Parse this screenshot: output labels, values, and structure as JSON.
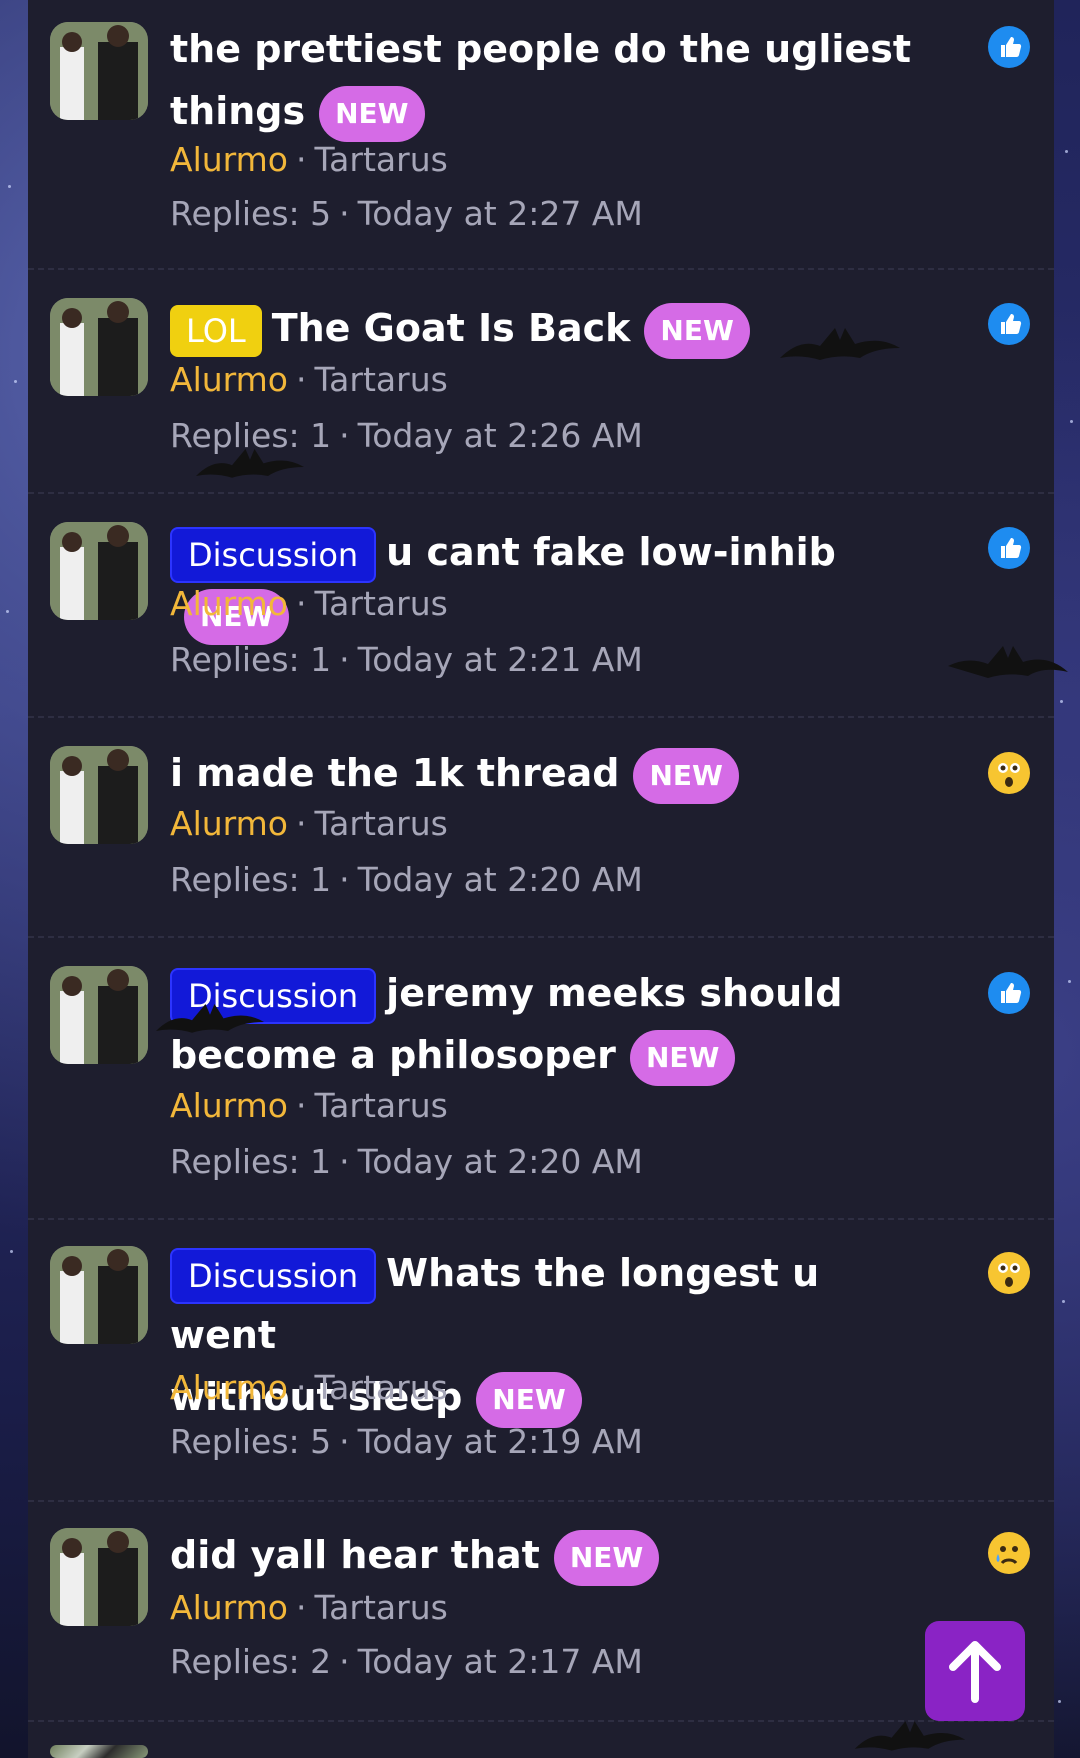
{
  "threads": [
    {
      "prefix": "",
      "title": "the prettiest people do the ugliest things",
      "title_line1": "the prettiest people do the ugliest",
      "title_line2": "things",
      "new_badge": "NEW",
      "author": "Alurmo",
      "forum": "Tartarus",
      "replies_label": "Replies: 5",
      "time": "Today at 2:27 AM",
      "reaction": "like-icon"
    },
    {
      "prefix": "LOL",
      "title": "The Goat Is Back",
      "new_badge": "NEW",
      "author": "Alurmo",
      "forum": "Tartarus",
      "replies_label": "Replies: 1",
      "time": "Today at 2:26 AM",
      "reaction": "like-icon"
    },
    {
      "prefix": "Discussion",
      "title": "u cant fake low-inhib",
      "new_badge": "NEW",
      "author": "Alurmo",
      "forum": "Tartarus",
      "replies_label": "Replies: 1",
      "time": "Today at 2:21 AM",
      "reaction": "like-icon"
    },
    {
      "prefix": "",
      "title": "i made the 1k thread",
      "new_badge": "NEW",
      "author": "Alurmo",
      "forum": "Tartarus",
      "replies_label": "Replies: 1",
      "time": "Today at 2:20 AM",
      "reaction": "wow-icon"
    },
    {
      "prefix": "Discussion",
      "title": "jeremy meeks should become a philosoper",
      "title_line1": "jeremy meeks should",
      "title_line2": "become a philosoper",
      "new_badge": "NEW",
      "author": "Alurmo",
      "forum": "Tartarus",
      "replies_label": "Replies: 1",
      "time": "Today at 2:20 AM",
      "reaction": "like-icon"
    },
    {
      "prefix": "Discussion",
      "title": "Whats the longest u went without sleep",
      "title_line1": "Whats the longest u went",
      "title_line2": "without sleep",
      "new_badge": "NEW",
      "author": "Alurmo",
      "forum": "Tartarus",
      "replies_label": "Replies: 5",
      "time": "Today at 2:19 AM",
      "reaction": "wow-icon"
    },
    {
      "prefix": "",
      "title": "did yall hear that",
      "new_badge": "NEW",
      "author": "Alurmo",
      "forum": "Tartarus",
      "replies_label": "Replies: 2",
      "time": "Today at 2:17 AM",
      "reaction": "sad-icon"
    }
  ],
  "separator": "·",
  "scroll_top_icon": "arrow-up-icon",
  "colors": {
    "panel": "#1e1e2e",
    "author": "#f2b73a",
    "new_badge": "#d56be6",
    "discussion_prefix": "#1219d8",
    "lol_prefix": "#f0d010",
    "scroll_button": "#8a23c5"
  }
}
